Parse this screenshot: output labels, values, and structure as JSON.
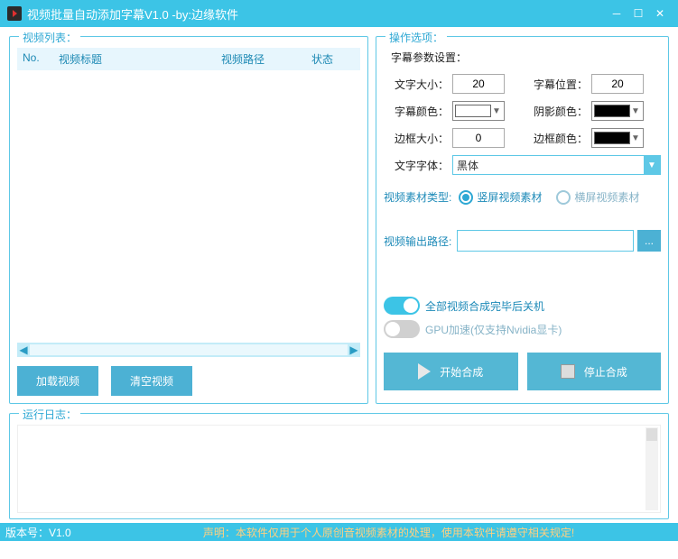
{
  "titlebar": {
    "title": "视频批量自动添加字幕V1.0 -by:边缘软件"
  },
  "groups": {
    "videoList": "视频列表：",
    "options": "操作选项：",
    "log": "运行日志："
  },
  "table": {
    "no": "No.",
    "title": "视频标题",
    "path": "视频路径",
    "status": "状态"
  },
  "buttons": {
    "load": "加载视频",
    "clear": "清空视频",
    "start": "开始合成",
    "stop": "停止合成"
  },
  "settings": {
    "headerLabel": "字幕参数设置：",
    "fontSize": {
      "label": "文字大小：",
      "value": "20"
    },
    "fontPos": {
      "label": "字幕位置：",
      "value": "20"
    },
    "subColor": {
      "label": "字幕颜色：",
      "value": "#ffffff"
    },
    "shadowColor": {
      "label": "阴影颜色：",
      "value": "#000000"
    },
    "borderSize": {
      "label": "边框大小：",
      "value": "0"
    },
    "borderColor": {
      "label": "边框颜色：",
      "value": "#000000"
    },
    "fontFamily": {
      "label": "文字字体：",
      "value": "黑体"
    }
  },
  "material": {
    "label": "视频素材类型:",
    "vertical": "竖屏视频素材",
    "horizontal": "横屏视频素材"
  },
  "output": {
    "label": "视频输出路径:",
    "value": "",
    "btn": "..."
  },
  "toggles": {
    "shutdown": "全部视频合成完毕后关机",
    "gpu": "GPU加速(仅支持Nvidia显卡)"
  },
  "status": {
    "version": "版本号：V1.0",
    "disclaimer": "声明：本软件仅用于个人原创音视频素材的处理，使用本软件请遵守相关规定!"
  }
}
